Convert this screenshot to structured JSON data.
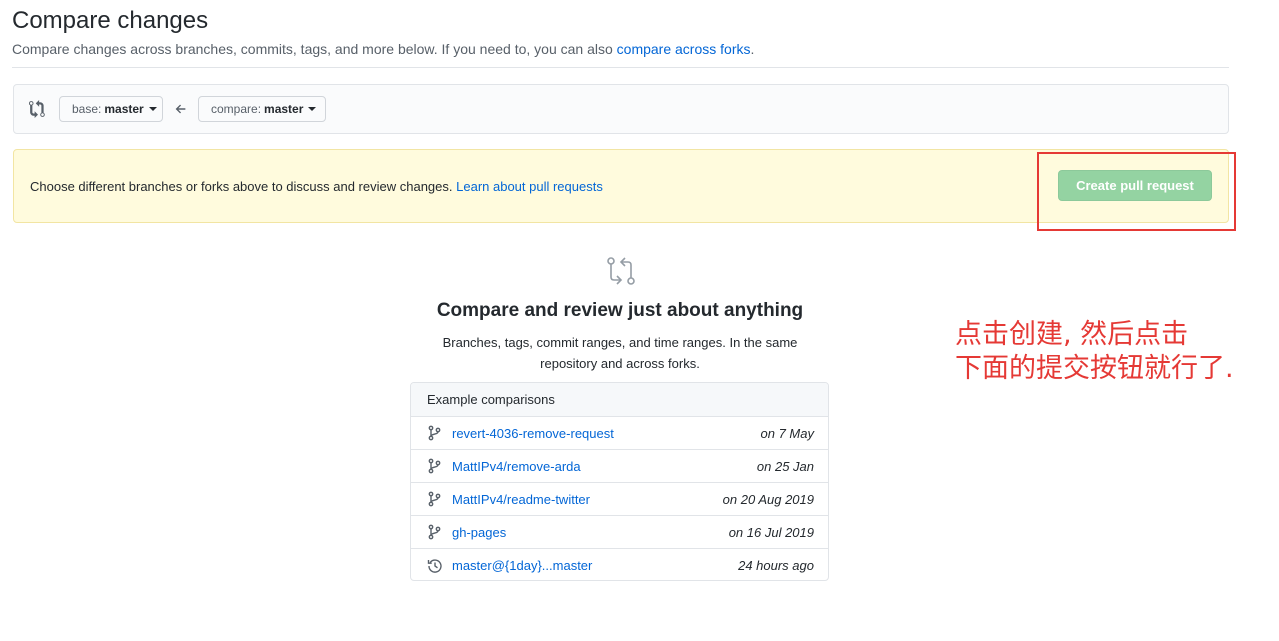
{
  "header": {
    "title": "Compare changes",
    "subtitle": "Compare changes across branches, commits, tags, and more below. If you need to, you can also ",
    "subtitle_link": "compare across forks",
    "subtitle_end": "."
  },
  "range": {
    "base_prefix": "base:",
    "base_branch": "master",
    "compare_prefix": "compare:",
    "compare_branch": "master"
  },
  "flash": {
    "message": "Choose different branches or forks above to discuss and review changes. ",
    "link": "Learn about pull requests",
    "create_button": "Create pull request"
  },
  "blankslate": {
    "title": "Compare and review just about anything",
    "description": "Branches, tags, commit ranges, and time ranges. In the same repository and across forks."
  },
  "examples": {
    "header": "Example comparisons",
    "rows": [
      {
        "name": "revert-4036-remove-request",
        "date": "on 7 May",
        "icon": "git-branch-icon"
      },
      {
        "name": "MattIPv4/remove-arda",
        "date": "on 25 Jan",
        "icon": "git-branch-icon"
      },
      {
        "name": "MattIPv4/readme-twitter",
        "date": "on 20 Aug 2019",
        "icon": "git-branch-icon"
      },
      {
        "name": "gh-pages",
        "date": "on 16 Jul 2019",
        "icon": "git-branch-icon"
      },
      {
        "name": "master@{1day}...master",
        "date": "24 hours ago",
        "icon": "history-icon"
      }
    ]
  },
  "annotation": {
    "line1": "点击创建, 然后点击",
    "line2": "下面的提交按钮就行了."
  },
  "colors": {
    "link": "#0366d6",
    "create_button_bg": "#94d3a2",
    "flash_bg": "#fffbdd",
    "annotation": "#e53935"
  }
}
